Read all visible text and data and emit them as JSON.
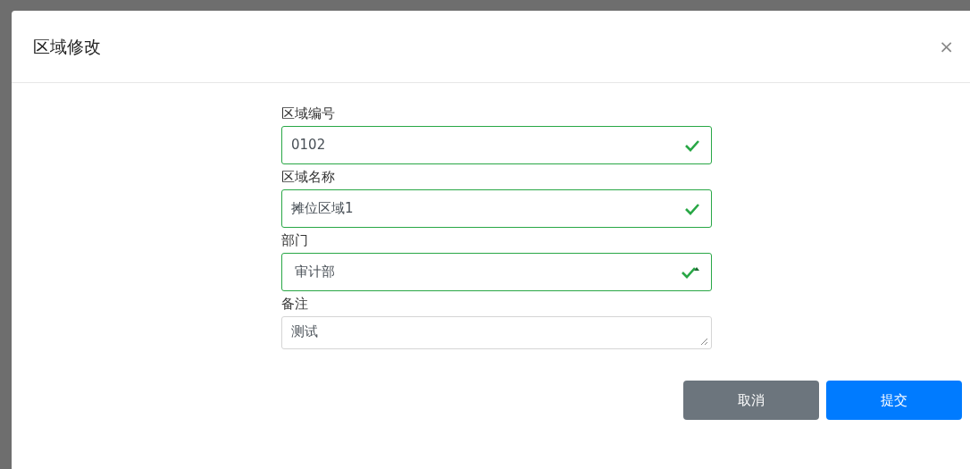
{
  "dialog": {
    "title": "区域修改",
    "close": "×"
  },
  "fields": [
    {
      "label": "区域编号",
      "kind": "input",
      "value": "0102",
      "valid": true
    },
    {
      "label": "区域名称",
      "kind": "input",
      "value": "摊位区域1",
      "valid": true
    },
    {
      "label": "部门",
      "kind": "select",
      "value": "审计部",
      "valid": true
    },
    {
      "label": "备注",
      "kind": "textarea",
      "value": "测试",
      "valid": false
    }
  ],
  "buttons": [
    {
      "label": "取消",
      "kind": "secondary"
    },
    {
      "label": "提交",
      "kind": "primary"
    }
  ]
}
